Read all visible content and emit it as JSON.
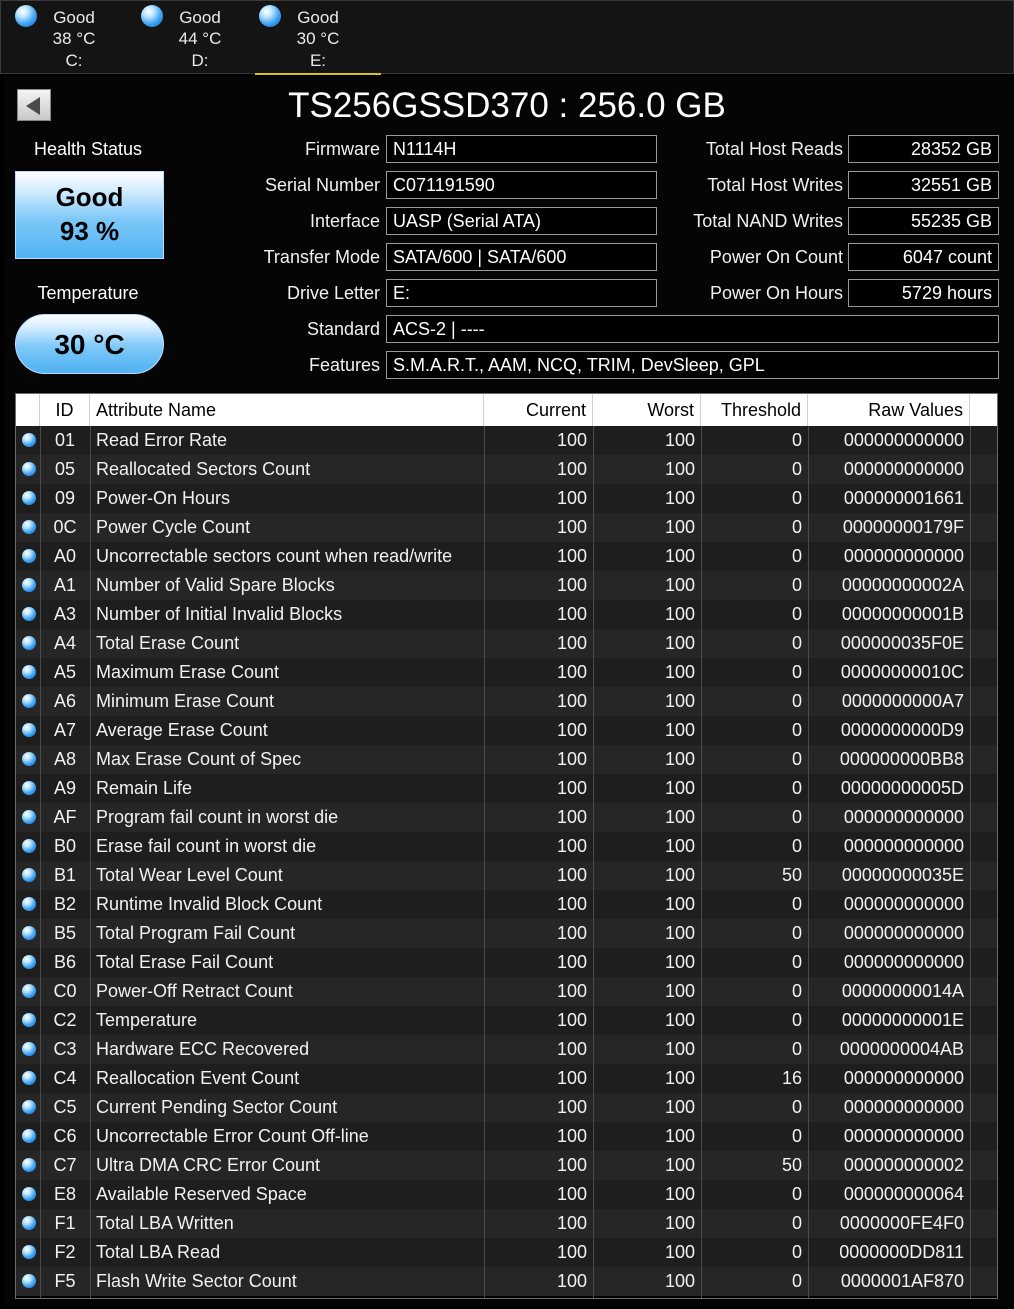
{
  "drives": [
    {
      "status": "Good",
      "temp": "38 °C",
      "letter": "C:"
    },
    {
      "status": "Good",
      "temp": "44 °C",
      "letter": "D:"
    },
    {
      "status": "Good",
      "temp": "30 °C",
      "letter": "E:"
    }
  ],
  "title": "TS256GSSD370 : 256.0 GB",
  "health": {
    "label": "Health Status",
    "status": "Good",
    "percent": "93 %"
  },
  "temperature": {
    "label": "Temperature",
    "value": "30 °C"
  },
  "info_left": [
    {
      "label": "Firmware",
      "value": "N1114H"
    },
    {
      "label": "Serial Number",
      "value": "C071191590"
    },
    {
      "label": "Interface",
      "value": "UASP (Serial ATA)"
    },
    {
      "label": "Transfer Mode",
      "value": "SATA/600 | SATA/600"
    },
    {
      "label": "Drive Letter",
      "value": "E:"
    }
  ],
  "info_right": [
    {
      "label": "Total Host Reads",
      "value": "28352 GB"
    },
    {
      "label": "Total Host Writes",
      "value": "32551 GB"
    },
    {
      "label": "Total NAND Writes",
      "value": "55235 GB"
    },
    {
      "label": "Power On Count",
      "value": "6047 count"
    },
    {
      "label": "Power On Hours",
      "value": "5729 hours"
    }
  ],
  "standard": {
    "label": "Standard",
    "value": "ACS-2 | ----"
  },
  "features": {
    "label": "Features",
    "value": "S.M.A.R.T., AAM, NCQ, TRIM, DevSleep, GPL"
  },
  "table": {
    "headers": {
      "id": "ID",
      "name": "Attribute Name",
      "current": "Current",
      "worst": "Worst",
      "threshold": "Threshold",
      "raw": "Raw Values"
    },
    "rows": [
      [
        "01",
        "Read Error Rate",
        "100",
        "100",
        "0",
        "000000000000"
      ],
      [
        "05",
        "Reallocated Sectors Count",
        "100",
        "100",
        "0",
        "000000000000"
      ],
      [
        "09",
        "Power-On Hours",
        "100",
        "100",
        "0",
        "000000001661"
      ],
      [
        "0C",
        "Power Cycle Count",
        "100",
        "100",
        "0",
        "00000000179F"
      ],
      [
        "A0",
        "Uncorrectable sectors count when read/write",
        "100",
        "100",
        "0",
        "000000000000"
      ],
      [
        "A1",
        "Number of Valid Spare Blocks",
        "100",
        "100",
        "0",
        "00000000002A"
      ],
      [
        "A3",
        "Number of Initial Invalid Blocks",
        "100",
        "100",
        "0",
        "00000000001B"
      ],
      [
        "A4",
        "Total Erase Count",
        "100",
        "100",
        "0",
        "000000035F0E"
      ],
      [
        "A5",
        "Maximum Erase Count",
        "100",
        "100",
        "0",
        "00000000010C"
      ],
      [
        "A6",
        "Minimum Erase Count",
        "100",
        "100",
        "0",
        "0000000000A7"
      ],
      [
        "A7",
        "Average Erase Count",
        "100",
        "100",
        "0",
        "0000000000D9"
      ],
      [
        "A8",
        "Max Erase Count of Spec",
        "100",
        "100",
        "0",
        "000000000BB8"
      ],
      [
        "A9",
        "Remain Life",
        "100",
        "100",
        "0",
        "00000000005D"
      ],
      [
        "AF",
        "Program fail count in worst die",
        "100",
        "100",
        "0",
        "000000000000"
      ],
      [
        "B0",
        "Erase fail count in worst die",
        "100",
        "100",
        "0",
        "000000000000"
      ],
      [
        "B1",
        "Total Wear Level Count",
        "100",
        "100",
        "50",
        "00000000035E"
      ],
      [
        "B2",
        "Runtime Invalid Block Count",
        "100",
        "100",
        "0",
        "000000000000"
      ],
      [
        "B5",
        "Total Program Fail Count",
        "100",
        "100",
        "0",
        "000000000000"
      ],
      [
        "B6",
        "Total Erase Fail Count",
        "100",
        "100",
        "0",
        "000000000000"
      ],
      [
        "C0",
        "Power-Off Retract Count",
        "100",
        "100",
        "0",
        "00000000014A"
      ],
      [
        "C2",
        "Temperature",
        "100",
        "100",
        "0",
        "00000000001E"
      ],
      [
        "C3",
        "Hardware ECC Recovered",
        "100",
        "100",
        "0",
        "0000000004AB"
      ],
      [
        "C4",
        "Reallocation Event Count",
        "100",
        "100",
        "16",
        "000000000000"
      ],
      [
        "C5",
        "Current Pending Sector Count",
        "100",
        "100",
        "0",
        "000000000000"
      ],
      [
        "C6",
        "Uncorrectable Error Count Off-line",
        "100",
        "100",
        "0",
        "000000000000"
      ],
      [
        "C7",
        "Ultra DMA CRC Error Count",
        "100",
        "100",
        "50",
        "000000000002"
      ],
      [
        "E8",
        "Available Reserved Space",
        "100",
        "100",
        "0",
        "000000000064"
      ],
      [
        "F1",
        "Total LBA Written",
        "100",
        "100",
        "0",
        "0000000FE4F0"
      ],
      [
        "F2",
        "Total LBA Read",
        "100",
        "100",
        "0",
        "0000000DD811"
      ],
      [
        "F5",
        "Flash Write Sector Count",
        "100",
        "100",
        "0",
        "0000001AF870"
      ]
    ]
  },
  "colors": {
    "good": "#4fb2f2",
    "active_tab_underline": "#d8c02a"
  },
  "icons": {
    "back": "back-arrow-icon",
    "status": "status-ball-icon"
  }
}
